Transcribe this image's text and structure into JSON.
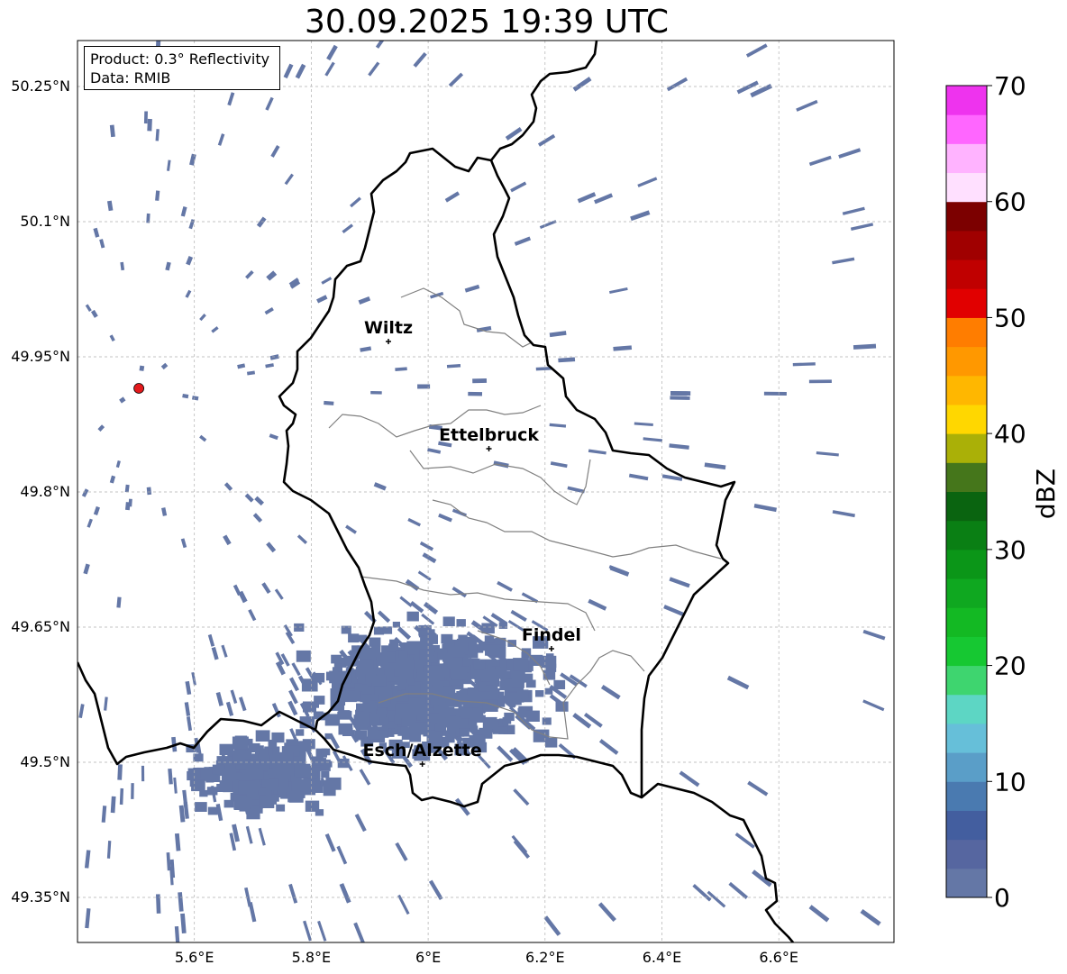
{
  "title": "30.09.2025 19:39 UTC",
  "info_box": {
    "product": "Product: 0.3° Reflectivity",
    "data_source": "Data: RMIB"
  },
  "map": {
    "lon_range": [
      5.4,
      6.8
    ],
    "lat_range": [
      49.3,
      50.3
    ],
    "lon_ticks": [
      {
        "value": 5.6,
        "label": "5.6°E"
      },
      {
        "value": 5.8,
        "label": "5.8°E"
      },
      {
        "value": 6.0,
        "label": "6°E"
      },
      {
        "value": 6.2,
        "label": "6.2°E"
      },
      {
        "value": 6.4,
        "label": "6.4°E"
      },
      {
        "value": 6.6,
        "label": "6.6°E"
      }
    ],
    "lat_ticks": [
      {
        "value": 50.25,
        "label": "50.25°N"
      },
      {
        "value": 50.1,
        "label": "50.1°N"
      },
      {
        "value": 49.95,
        "label": "49.95°N"
      },
      {
        "value": 49.8,
        "label": "49.8°N"
      },
      {
        "value": 49.65,
        "label": "49.65°N"
      },
      {
        "value": 49.5,
        "label": "49.5°N"
      },
      {
        "value": 49.35,
        "label": "49.35°N"
      }
    ],
    "radar_site": {
      "lon": 5.505,
      "lat": 49.915,
      "color": "#e41a1c"
    },
    "cities": [
      {
        "name": "Wiltz",
        "lon": 5.932,
        "lat": 49.967
      },
      {
        "name": "Ettelbruck",
        "lon": 6.104,
        "lat": 49.848
      },
      {
        "name": "Findel",
        "lon": 6.211,
        "lat": 49.626
      },
      {
        "name": "Esch/Alzette",
        "lon": 5.99,
        "lat": 49.498
      }
    ],
    "echo_color": "#6477a6",
    "land_color": "#ffffff",
    "border_color": "#000000",
    "canton_color": "#808080"
  },
  "colorbar": {
    "label": "dBZ",
    "min": 0,
    "max": 70,
    "ticks": [
      {
        "value": 0,
        "label": "0"
      },
      {
        "value": 10,
        "label": "10"
      },
      {
        "value": 20,
        "label": "20"
      },
      {
        "value": 30,
        "label": "30"
      },
      {
        "value": 40,
        "label": "40"
      },
      {
        "value": 50,
        "label": "50"
      },
      {
        "value": 60,
        "label": "60"
      },
      {
        "value": 70,
        "label": "70"
      }
    ],
    "colors": [
      "#6477a6",
      "#5666a0",
      "#435e9f",
      "#4a7ab0",
      "#5a9ec8",
      "#66bfd9",
      "#5dd6c4",
      "#3ed56f",
      "#16c832",
      "#13b923",
      "#0fa820",
      "#0b9618",
      "#0a7f14",
      "#0a6410",
      "#45761b",
      "#aab007",
      "#ffd700",
      "#ffb700",
      "#ff9800",
      "#ff7d00",
      "#e10000",
      "#c00000",
      "#a00000",
      "#7c0000",
      "#ffe0ff",
      "#ffb3ff",
      "#ff66ff",
      "#ee33ee"
    ]
  }
}
